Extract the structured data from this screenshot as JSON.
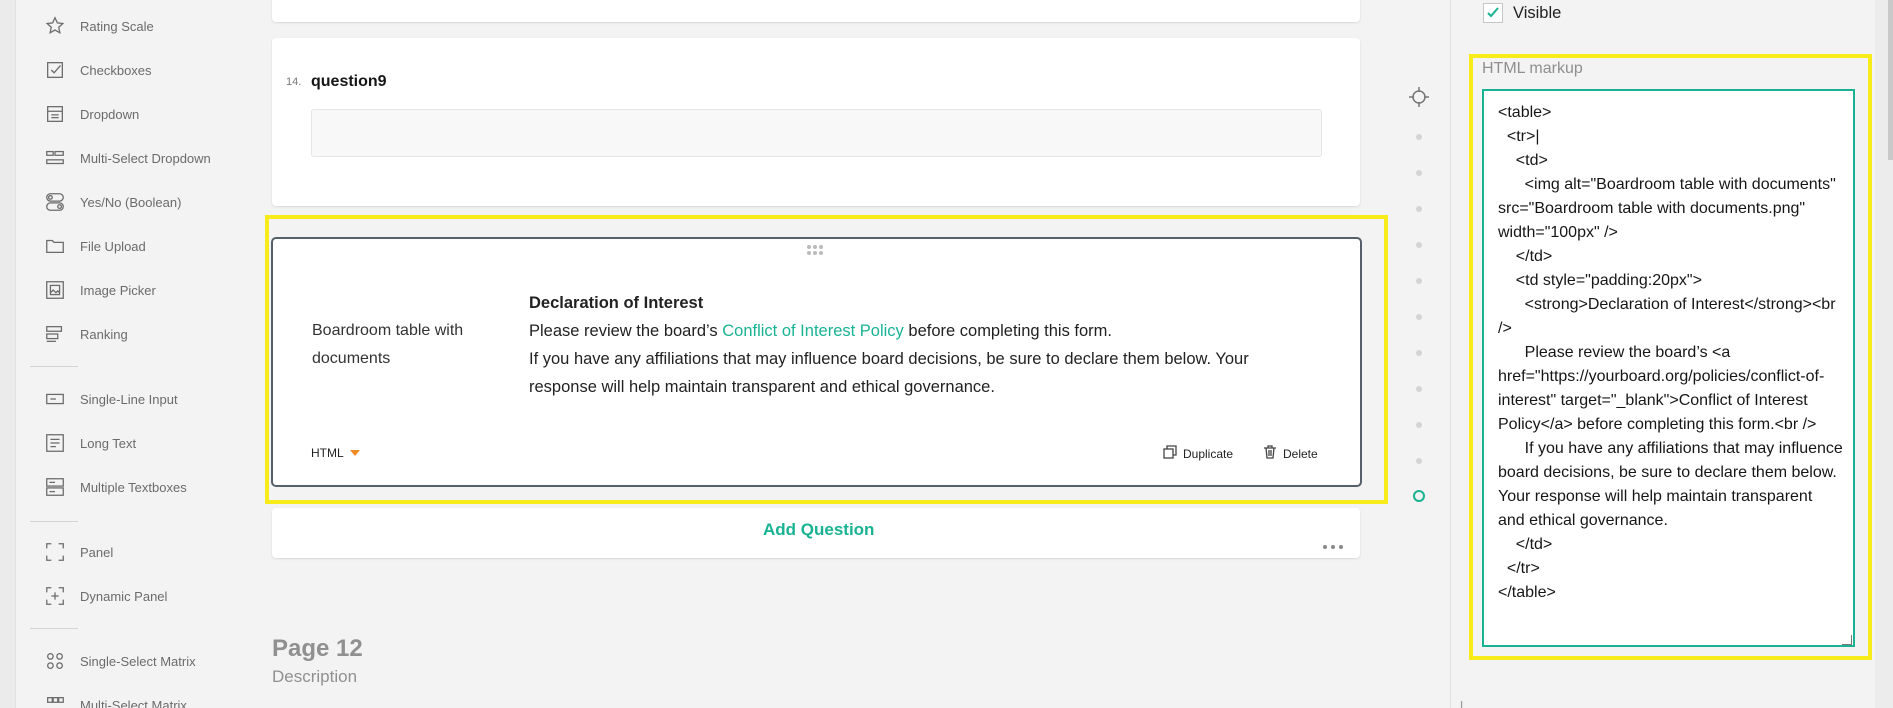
{
  "toolbox": {
    "items": [
      {
        "label": "Rating Scale",
        "icon": "star-icon"
      },
      {
        "label": "Checkboxes",
        "icon": "checkbox-icon"
      },
      {
        "label": "Dropdown",
        "icon": "dropdown-icon"
      },
      {
        "label": "Multi-Select Dropdown",
        "icon": "tagbox-icon"
      },
      {
        "label": "Yes/No (Boolean)",
        "icon": "toggle-icon"
      },
      {
        "label": "File Upload",
        "icon": "folder-icon"
      },
      {
        "label": "Image Picker",
        "icon": "image-icon"
      },
      {
        "label": "Ranking",
        "icon": "ranking-icon"
      },
      {
        "label": "Single-Line Input",
        "icon": "text-input-icon"
      },
      {
        "label": "Long Text",
        "icon": "long-text-icon"
      },
      {
        "label": "Multiple Textboxes",
        "icon": "multiple-text-icon"
      },
      {
        "label": "Panel",
        "icon": "panel-icon"
      },
      {
        "label": "Dynamic Panel",
        "icon": "dynamic-panel-icon"
      },
      {
        "label": "Single-Select Matrix",
        "icon": "matrix-icon"
      },
      {
        "label": "Multi-Select Matrix",
        "icon": "matrix-multi-icon"
      }
    ]
  },
  "question": {
    "number": "14.",
    "title": "question9"
  },
  "html_question": {
    "image_alt": "Boardroom table with documents",
    "heading": "Declaration of Interest",
    "line1_before": "Please review the board’s ",
    "link_text": "Conflict of Interest Policy",
    "line1_after": " before completing this form.",
    "line2": "If you have any affiliations that may influence board decisions, be sure to declare them below. Your response will help maintain transparent and ethical governance.",
    "type_label": "HTML",
    "duplicate_label": "Duplicate",
    "delete_label": "Delete"
  },
  "add_question_label": "Add Question",
  "page": {
    "title": "Page 12",
    "description": "Description"
  },
  "properties": {
    "visible_label": "Visible",
    "visible_checked": true,
    "html_markup_label": "HTML markup",
    "html_markup_value": "<table>\n  <tr>|\n    <td>\n      <img alt=\"Boardroom table with documents\" src=\"Boardroom table with documents.png\" width=\"100px\" />\n    </td>\n    <td style=\"padding:20px\">\n      <strong>Declaration of Interest</strong><br />\n      Please review the board’s <a href=\"https://yourboard.org/policies/conflict-of-interest\" target=\"_blank\">Conflict of Interest Policy</a> before completing this form.<br />\n      If you have any affiliations that may influence board decisions, be sure to declare them below. Your response will help maintain transparent and ethical governance.\n    </td>\n  </tr>\n</table>"
  },
  "colors": {
    "accent": "#19b394",
    "highlight": "#f7ec1a",
    "caret": "#f08a24"
  }
}
